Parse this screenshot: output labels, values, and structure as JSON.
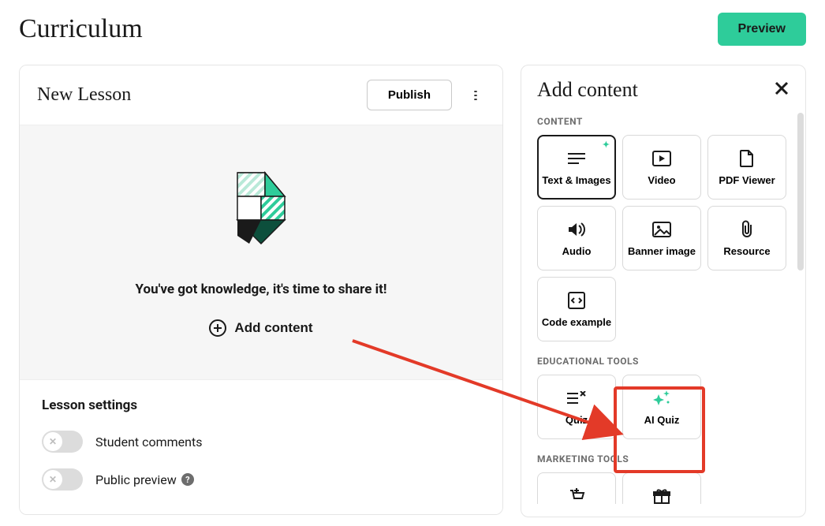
{
  "header": {
    "title": "Curriculum",
    "preview_label": "Preview"
  },
  "lesson": {
    "title": "New Lesson",
    "publish_label": "Publish",
    "empty_message": "You've got knowledge, it's time to share it!",
    "add_content_label": "Add content"
  },
  "settings": {
    "title": "Lesson settings",
    "student_comments_label": "Student comments",
    "public_preview_label": "Public preview"
  },
  "content_panel": {
    "title": "Add content",
    "sections": {
      "content_label": "CONTENT",
      "educational_label": "EDUCATIONAL TOOLS",
      "marketing_label": "MARKETING TOOLS"
    },
    "tiles": {
      "text_images": "Text & Images",
      "video": "Video",
      "pdf_viewer": "PDF Viewer",
      "audio": "Audio",
      "banner_image": "Banner image",
      "resource": "Resource",
      "code_example": "Code example",
      "quiz": "Quiz",
      "ai_quiz": "AI Quiz"
    }
  }
}
